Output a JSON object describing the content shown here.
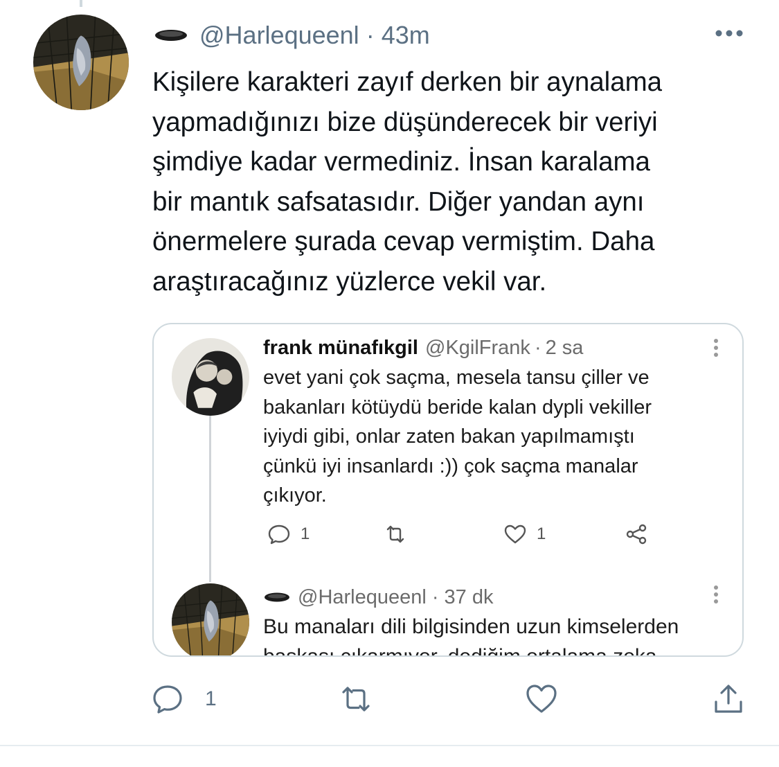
{
  "main_tweet": {
    "handle": "@Harlequeenl",
    "separator": "·",
    "time": "43m",
    "badge_icon": "hole-emoji-icon",
    "text": "Kişilere karakteri zayıf derken bir aynalama\nyapmadığınızı bize düşünderecek bir veriyi\nşimdiye kadar vermediniz. İnsan karalama\nbir mantık safsatasıdır. Diğer yandan aynı\nönermelere şurada cevap vermiştim. Daha\naraştıracağınız yüzlerce vekil var.",
    "reply_count": "1",
    "retweet_count": "",
    "like_count": ""
  },
  "quote": {
    "tweet1": {
      "name": "frank münafıkgil",
      "handle": "@KgilFrank",
      "separator": "·",
      "time": "2 sa",
      "text": "evet yani çok saçma, mesela tansu çiller ve\nbakanları kötüydü beride kalan dypli vekiller\niyiydi gibi, onlar zaten bakan yapılmamıştı\nçünkü iyi insanlardı :)) çok saçma manalar\nçıkıyor.",
      "reply_count": "1",
      "like_count": "1"
    },
    "tweet2": {
      "handle": "@Harlequeenl",
      "separator": "·",
      "time": "37 dk",
      "text": "Bu manaları dili bilgisinden uzun kimselerden\nbaşkası çıkarmıyor, dediğim ortalama zeka"
    }
  },
  "colors": {
    "secondary_text": "#5b7083",
    "border": "#cfd9de",
    "icon": "#5b7083"
  }
}
